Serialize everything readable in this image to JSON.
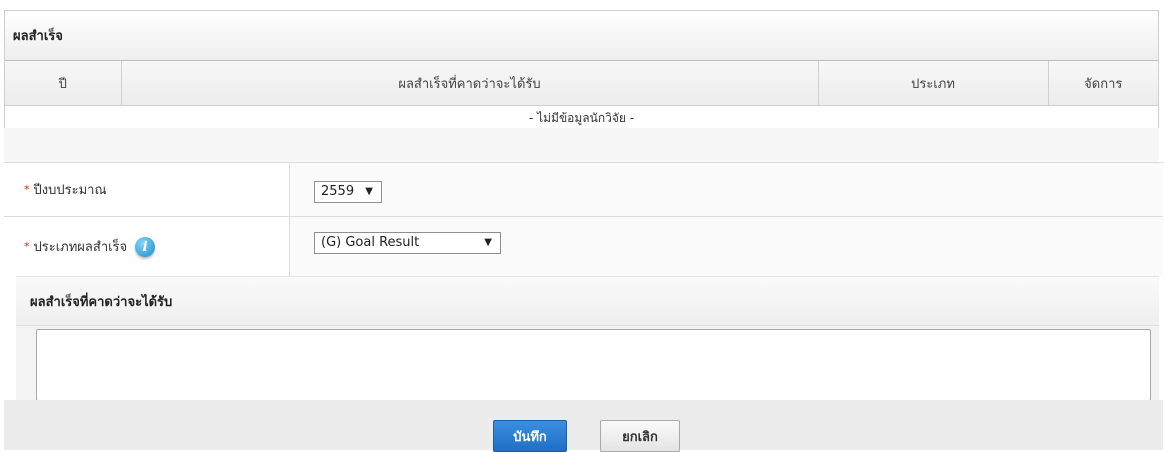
{
  "panel": {
    "title": "ผลสำเร็จ",
    "columns": [
      "ปี",
      "ผลสำเร็จที่คาดว่าจะได้รับ",
      "ประเภท",
      "จัดการ"
    ],
    "empty_message": "- ไม่มีข้อมูลนักวิจัย -"
  },
  "form": {
    "budget_year": {
      "label": "ปีงบประมาณ",
      "required_mark": "*",
      "value": "2559"
    },
    "result_type": {
      "label": "ประเภทผลสำเร็จ",
      "required_mark": "*",
      "info_glyph": "i",
      "value": "(G) Goal Result"
    },
    "expected_result": {
      "label": "ผลสำเร็จที่คาดว่าจะได้รับ",
      "value": ""
    }
  },
  "buttons": {
    "save": "บันทึก",
    "cancel": "ยกเลิก"
  },
  "colors": {
    "accent": "#1f6fc4",
    "required": "#d9251c",
    "info": "#1a8ed0"
  },
  "icons": {
    "info": "info-icon",
    "dropdown": "chevron-down-icon"
  }
}
